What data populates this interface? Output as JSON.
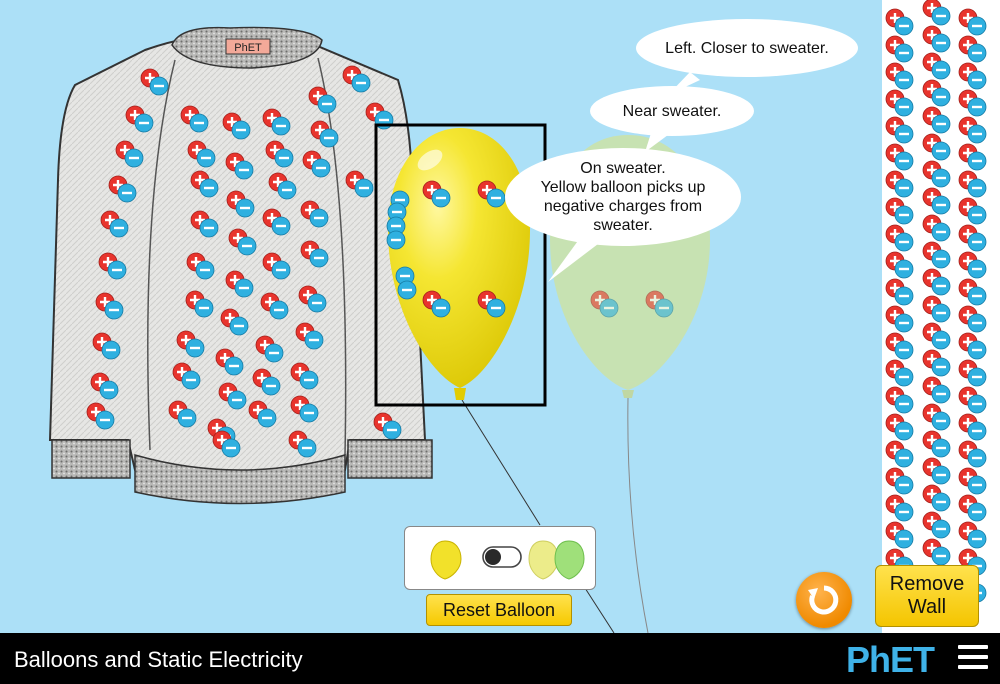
{
  "speech_bubbles": {
    "left_closer": "Left. Closer to sweater.",
    "near": "Near sweater.",
    "on_sweater_line1": "On sweater.",
    "on_sweater_line2": "Yellow balloon picks up",
    "on_sweater_line3": "negative charges from",
    "on_sweater_line4": "sweater."
  },
  "sweater": {
    "label": "PhET"
  },
  "controls": {
    "reset_balloon_label": "Reset Balloon",
    "remove_wall_line1": "Remove",
    "remove_wall_line2": "Wall",
    "two_balloons_toggle": "off"
  },
  "navbar": {
    "title": "Balloons and Static Electricity",
    "logo": "PhET"
  },
  "colors": {
    "background": "#ace0f7",
    "positive_charge": "#e8342d",
    "negative_charge": "#2fb0e0",
    "button_yellow": "#ffd700",
    "yellow_balloon": "#f2e12a",
    "green_balloon": "#9fe07a",
    "navbar": "#000000"
  },
  "icons": [
    "reset-all-icon",
    "hamburger-menu-icon",
    "yellow-balloon-icon",
    "green-balloon-icon"
  ]
}
